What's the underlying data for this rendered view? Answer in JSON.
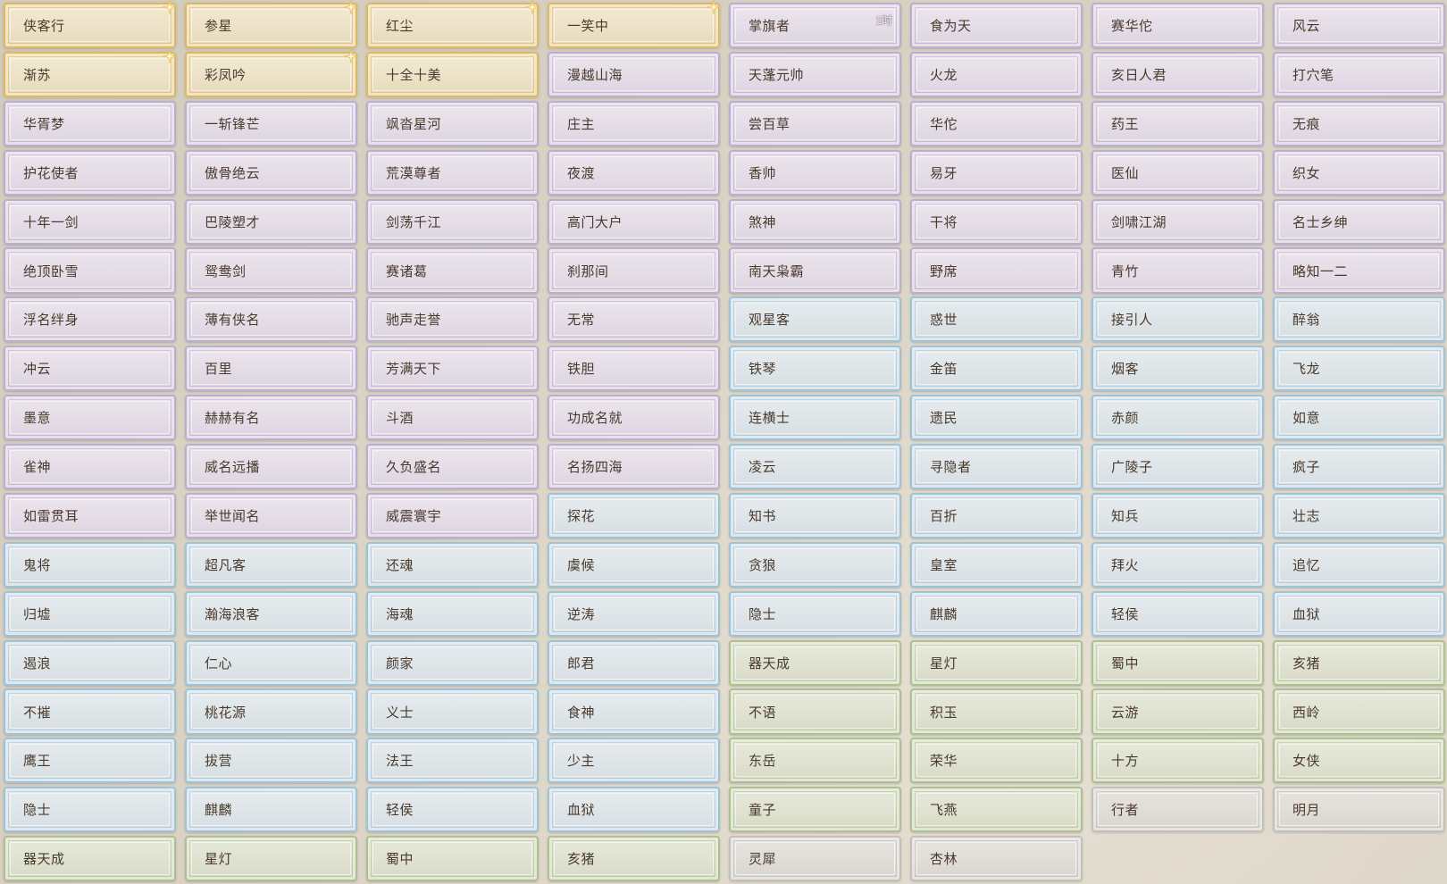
{
  "title_grid": {
    "cards": [
      {
        "label": "侠客行",
        "tier": "gold",
        "icon": "sparkle-icon"
      },
      {
        "label": "参星",
        "tier": "gold",
        "icon": "sparkle-icon"
      },
      {
        "label": "红尘",
        "tier": "gold",
        "icon": "sparkle-icon"
      },
      {
        "label": "一笑中",
        "tier": "gold",
        "icon": "sparkle-icon"
      },
      {
        "label": "掌旗者",
        "tier": "purple",
        "badge": "1时"
      },
      {
        "label": "食为天",
        "tier": "purple"
      },
      {
        "label": "赛华佗",
        "tier": "purple"
      },
      {
        "label": "风云",
        "tier": "purple"
      },
      {
        "label": "渐苏",
        "tier": "gold",
        "icon": "sparkle-icon"
      },
      {
        "label": "彩凤吟",
        "tier": "gold",
        "icon": "sparkle-icon"
      },
      {
        "label": "十全十美",
        "tier": "gold"
      },
      {
        "label": "漫越山海",
        "tier": "purple"
      },
      {
        "label": "天蓬元帅",
        "tier": "purple"
      },
      {
        "label": "火龙",
        "tier": "purple"
      },
      {
        "label": "亥日人君",
        "tier": "purple"
      },
      {
        "label": "打穴笔",
        "tier": "purple"
      },
      {
        "label": "华胥梦",
        "tier": "purple"
      },
      {
        "label": "一斩锋芒",
        "tier": "purple"
      },
      {
        "label": "飒沓星河",
        "tier": "purple"
      },
      {
        "label": "庄主",
        "tier": "purple"
      },
      {
        "label": "尝百草",
        "tier": "purple"
      },
      {
        "label": "华佗",
        "tier": "purple"
      },
      {
        "label": "药王",
        "tier": "purple"
      },
      {
        "label": "无痕",
        "tier": "purple"
      },
      {
        "label": "护花使者",
        "tier": "purple"
      },
      {
        "label": "傲骨绝云",
        "tier": "purple"
      },
      {
        "label": "荒漠尊者",
        "tier": "purple"
      },
      {
        "label": "夜渡",
        "tier": "purple"
      },
      {
        "label": "香帅",
        "tier": "purple"
      },
      {
        "label": "易牙",
        "tier": "purple"
      },
      {
        "label": "医仙",
        "tier": "purple"
      },
      {
        "label": "织女",
        "tier": "purple"
      },
      {
        "label": "十年一剑",
        "tier": "purple"
      },
      {
        "label": "巴陵塑才",
        "tier": "purple"
      },
      {
        "label": "剑荡千江",
        "tier": "purple"
      },
      {
        "label": "高门大户",
        "tier": "purple"
      },
      {
        "label": "煞神",
        "tier": "purple"
      },
      {
        "label": "干将",
        "tier": "purple"
      },
      {
        "label": "剑啸江湖",
        "tier": "purple"
      },
      {
        "label": "名士乡绅",
        "tier": "purple"
      },
      {
        "label": "绝顶卧雪",
        "tier": "purple"
      },
      {
        "label": "鸳鸯剑",
        "tier": "purple"
      },
      {
        "label": "赛诸葛",
        "tier": "purple"
      },
      {
        "label": "刹那间",
        "tier": "purple"
      },
      {
        "label": "南天枭霸",
        "tier": "purple"
      },
      {
        "label": "野席",
        "tier": "purple"
      },
      {
        "label": "青竹",
        "tier": "purple"
      },
      {
        "label": "略知一二",
        "tier": "purple"
      },
      {
        "label": "浮名绊身",
        "tier": "purple"
      },
      {
        "label": "薄有侠名",
        "tier": "purple"
      },
      {
        "label": "驰声走誉",
        "tier": "purple"
      },
      {
        "label": "无常",
        "tier": "purple"
      },
      {
        "label": "观星客",
        "tier": "blue"
      },
      {
        "label": "惑世",
        "tier": "blue"
      },
      {
        "label": "接引人",
        "tier": "blue"
      },
      {
        "label": "醉翁",
        "tier": "blue"
      },
      {
        "label": "冲云",
        "tier": "purple"
      },
      {
        "label": "百里",
        "tier": "purple"
      },
      {
        "label": "芳满天下",
        "tier": "purple"
      },
      {
        "label": "铁胆",
        "tier": "purple"
      },
      {
        "label": "铁琴",
        "tier": "blue"
      },
      {
        "label": "金笛",
        "tier": "blue"
      },
      {
        "label": "烟客",
        "tier": "blue"
      },
      {
        "label": "飞龙",
        "tier": "blue"
      },
      {
        "label": "墨意",
        "tier": "purple"
      },
      {
        "label": "赫赫有名",
        "tier": "purple"
      },
      {
        "label": "斗酒",
        "tier": "purple"
      },
      {
        "label": "功成名就",
        "tier": "purple"
      },
      {
        "label": "连横士",
        "tier": "blue"
      },
      {
        "label": "遗民",
        "tier": "blue"
      },
      {
        "label": "赤颜",
        "tier": "blue"
      },
      {
        "label": "如意",
        "tier": "blue"
      },
      {
        "label": "雀神",
        "tier": "purple"
      },
      {
        "label": "威名远播",
        "tier": "purple"
      },
      {
        "label": "久负盛名",
        "tier": "purple"
      },
      {
        "label": "名扬四海",
        "tier": "purple"
      },
      {
        "label": "凌云",
        "tier": "blue"
      },
      {
        "label": "寻隐者",
        "tier": "blue"
      },
      {
        "label": "广陵子",
        "tier": "blue"
      },
      {
        "label": "疯子",
        "tier": "blue"
      },
      {
        "label": "如雷贯耳",
        "tier": "purple"
      },
      {
        "label": "举世闻名",
        "tier": "purple"
      },
      {
        "label": "威震寰宇",
        "tier": "purple"
      },
      {
        "label": "探花",
        "tier": "blue"
      },
      {
        "label": "知书",
        "tier": "blue"
      },
      {
        "label": "百折",
        "tier": "blue"
      },
      {
        "label": "知兵",
        "tier": "blue"
      },
      {
        "label": "壮志",
        "tier": "blue"
      },
      {
        "label": "鬼将",
        "tier": "blue"
      },
      {
        "label": "超凡客",
        "tier": "blue"
      },
      {
        "label": "还魂",
        "tier": "blue"
      },
      {
        "label": "虞候",
        "tier": "blue"
      },
      {
        "label": "贪狼",
        "tier": "blue"
      },
      {
        "label": "皇室",
        "tier": "blue"
      },
      {
        "label": "拜火",
        "tier": "blue"
      },
      {
        "label": "追忆",
        "tier": "blue"
      },
      {
        "label": "归墟",
        "tier": "blue"
      },
      {
        "label": "瀚海浪客",
        "tier": "blue"
      },
      {
        "label": "海魂",
        "tier": "blue"
      },
      {
        "label": "逆涛",
        "tier": "blue"
      },
      {
        "label": "隐士",
        "tier": "blue"
      },
      {
        "label": "麒麟",
        "tier": "blue"
      },
      {
        "label": "轻侯",
        "tier": "blue"
      },
      {
        "label": "血狱",
        "tier": "blue"
      },
      {
        "label": "遏浪",
        "tier": "blue"
      },
      {
        "label": "仁心",
        "tier": "blue"
      },
      {
        "label": "颜家",
        "tier": "blue"
      },
      {
        "label": "郎君",
        "tier": "blue"
      },
      {
        "label": "器天成",
        "tier": "green"
      },
      {
        "label": "星灯",
        "tier": "green"
      },
      {
        "label": "蜀中",
        "tier": "green"
      },
      {
        "label": "亥猪",
        "tier": "green"
      },
      {
        "label": "不摧",
        "tier": "blue"
      },
      {
        "label": "桃花源",
        "tier": "blue"
      },
      {
        "label": "义士",
        "tier": "blue"
      },
      {
        "label": "食神",
        "tier": "blue"
      },
      {
        "label": "不语",
        "tier": "green"
      },
      {
        "label": "积玉",
        "tier": "green"
      },
      {
        "label": "云游",
        "tier": "green"
      },
      {
        "label": "西岭",
        "tier": "green"
      },
      {
        "label": "鹰王",
        "tier": "blue"
      },
      {
        "label": "拔营",
        "tier": "blue"
      },
      {
        "label": "法王",
        "tier": "blue"
      },
      {
        "label": "少主",
        "tier": "blue"
      },
      {
        "label": "东岳",
        "tier": "green"
      },
      {
        "label": "荣华",
        "tier": "green"
      },
      {
        "label": "十方",
        "tier": "green"
      },
      {
        "label": "女侠",
        "tier": "green"
      },
      {
        "label": "隐士",
        "tier": "blue"
      },
      {
        "label": "麒麟",
        "tier": "blue"
      },
      {
        "label": "轻侯",
        "tier": "blue"
      },
      {
        "label": "血狱",
        "tier": "blue"
      },
      {
        "label": "童子",
        "tier": "green"
      },
      {
        "label": "飞燕",
        "tier": "green"
      },
      {
        "label": "行者",
        "tier": "grey"
      },
      {
        "label": "明月",
        "tier": "grey"
      },
      {
        "label": "器天成",
        "tier": "green"
      },
      {
        "label": "星灯",
        "tier": "green"
      },
      {
        "label": "蜀中",
        "tier": "green"
      },
      {
        "label": "亥猪",
        "tier": "green"
      },
      {
        "label": "灵犀",
        "tier": "grey"
      },
      {
        "label": "杏林",
        "tier": "grey"
      }
    ]
  },
  "tier_colors": {
    "gold": "#d9b86a",
    "purple": "#bcaed0",
    "blue": "#9fc3d6",
    "green": "#aebf90",
    "grey": "#c3c0bb",
    "label_text": "#4a3a2c"
  }
}
